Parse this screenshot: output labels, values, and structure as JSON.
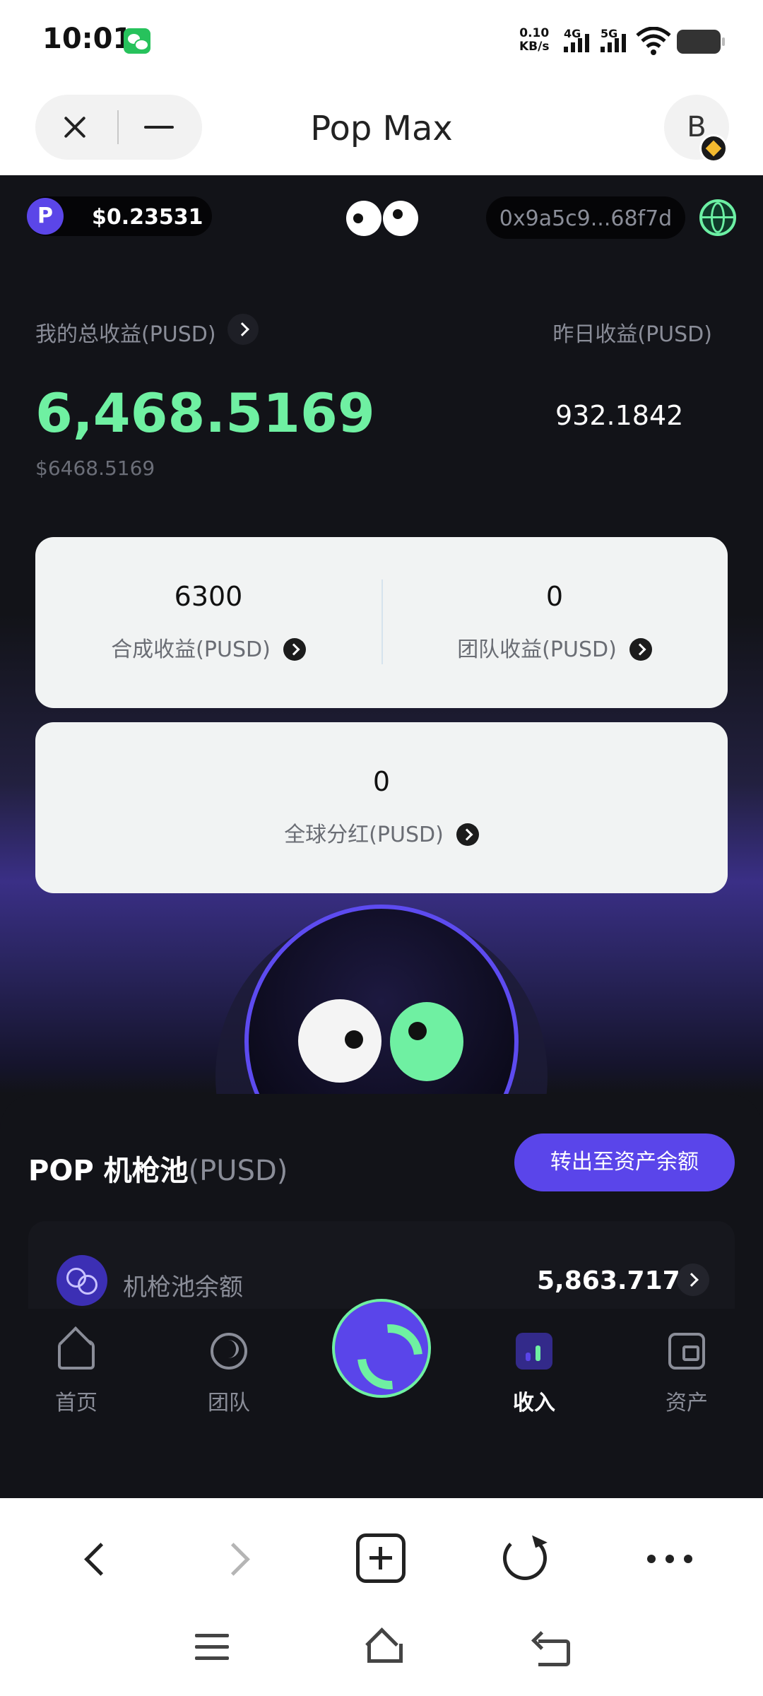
{
  "status_bar": {
    "time": "10:01",
    "notification_icon": "wechat-icon",
    "net_speed_value": "0.10",
    "net_speed_unit": "KB/s",
    "signal_1_label": "4G",
    "signal_2_label": "5G",
    "wifi_icon": "wifi-icon",
    "battery_icon": "battery-icon"
  },
  "mini_program": {
    "title": "Pop Max",
    "avatar_letter": "B",
    "close_icon": "close-icon",
    "minimize_icon": "minimize-icon",
    "badge_icon": "bnb-chain-icon"
  },
  "app_header": {
    "token_price": "$0.23531",
    "wallet_address": "0x9a5c9...68f7d",
    "logo_icon": "pop-eyes-logo-icon",
    "network_icon": "globe-icon"
  },
  "earnings": {
    "total_label": "我的总收益(PUSD)",
    "total_value": "6,468.5169",
    "total_usd": "$6468.5169",
    "yesterday_label": "昨日收益(PUSD)",
    "yesterday_value": "932.1842"
  },
  "cards": {
    "synthesis": {
      "value": "6300",
      "label": "合成收益(PUSD)"
    },
    "team": {
      "value": "0",
      "label": "团队收益(PUSD)"
    },
    "global": {
      "value": "0",
      "label": "全球分红(PUSD)"
    }
  },
  "pool": {
    "title": "POP 机枪池",
    "unit": "(PUSD)",
    "transfer_button": "转出至资产余额",
    "balance_label": "机枪池余额",
    "balance_value": "5,863.7173"
  },
  "tabs": [
    {
      "label": "首页",
      "icon": "home-icon",
      "active": false
    },
    {
      "label": "团队",
      "icon": "team-icon",
      "active": false
    },
    {
      "label": "",
      "icon": "swap-icon",
      "active": false
    },
    {
      "label": "收入",
      "icon": "income-chart-icon",
      "active": true
    },
    {
      "label": "资产",
      "icon": "wallet-icon",
      "active": false
    }
  ],
  "colors": {
    "accent_green": "#6ff0a2",
    "accent_purple": "#5a45ea",
    "background_dark": "#121318"
  }
}
